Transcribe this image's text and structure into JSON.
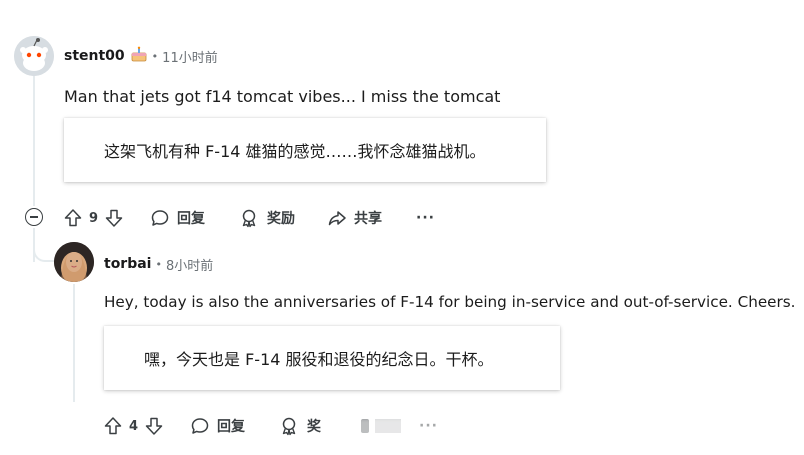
{
  "comment1": {
    "username": "stent00",
    "flair_icon": "cake-icon",
    "time": "11小时前",
    "body": "Man that jets got f14 tomcat vibes... I miss the tomcat",
    "translation": "这架飞机有种 F-14 雄猫的感觉……我怀念雄猫战机。",
    "votes": "9",
    "reply_label": "回复",
    "award_label": "奖励",
    "share_label": "共享",
    "more_label": "···"
  },
  "comment2": {
    "username": "torbai",
    "time": "8小时前",
    "body": "Hey, today is also the anniversaries of F-14 for being in-service and out-of-service. Cheers.",
    "translation": "嘿，今天也是 F-14 服役和退役的纪念日。干杯。",
    "votes": "4",
    "reply_label": "回复",
    "award_label": "奖",
    "more_label": "···"
  },
  "colors": {
    "thread_line": "#e5ebee",
    "text": "#1c1c1c",
    "meta": "#6b7176"
  }
}
